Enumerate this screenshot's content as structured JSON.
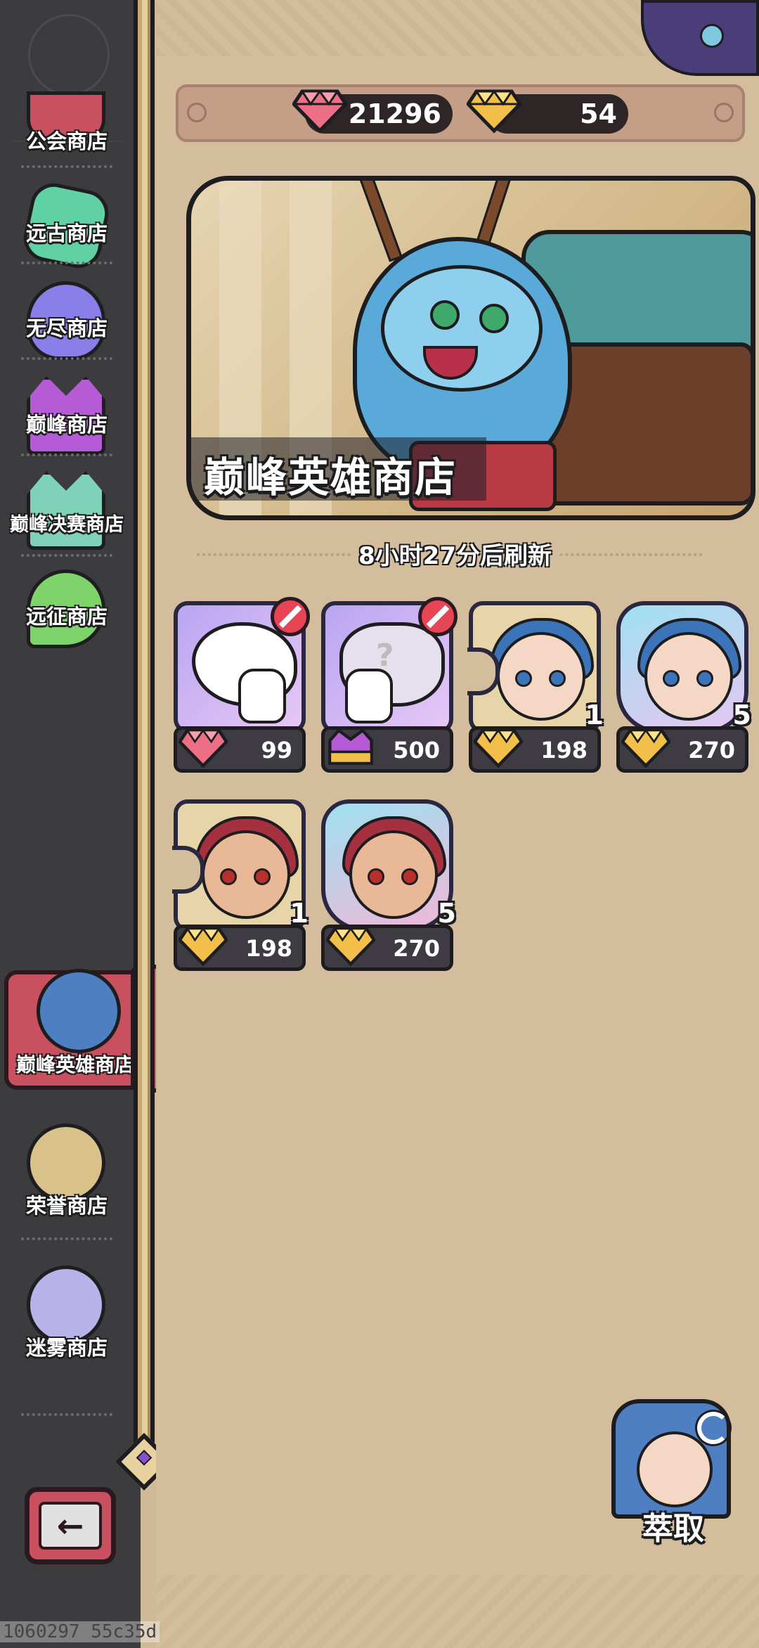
{
  "currencies": [
    {
      "name": "pink-gem",
      "value": "21296",
      "color": "#ec6f86"
    },
    {
      "name": "gold-gem",
      "value": "54",
      "color": "#f2c04a"
    }
  ],
  "banner": {
    "title": "巅峰英雄商店"
  },
  "refresh": {
    "text": "8小时27分后刷新"
  },
  "sidebar": {
    "items": [
      {
        "label": "公会商店",
        "icon": "guild-icon",
        "color": "#c9505f"
      },
      {
        "label": "远古商店",
        "icon": "ancient-crystal-icon",
        "color": "#5fd1a5"
      },
      {
        "label": "无尽商店",
        "icon": "slime-icon",
        "color": "#8a7ee8"
      },
      {
        "label": "巅峰商店",
        "icon": "crown-icon",
        "color": "#b55bd6"
      },
      {
        "label": "巅峰决赛商店",
        "icon": "finals-crown-icon",
        "color": "#7fd1b8"
      },
      {
        "label": "远征商店",
        "icon": "green-slime-icon",
        "color": "#7ed36a"
      },
      {
        "label": "巅峰英雄商店",
        "icon": "hero-portrait-icon",
        "color": "#4d7fc2"
      },
      {
        "label": "荣誉商店",
        "icon": "crossed-swords-icon",
        "color": "#d8c28a"
      },
      {
        "label": "迷雾商店",
        "icon": "mist-orb-icon",
        "color": "#b7b2e8"
      }
    ]
  },
  "items": [
    {
      "type": "blob-hand",
      "price": "99",
      "currency": "pink-gem",
      "blocked": true,
      "qty": ""
    },
    {
      "type": "mystery-hand",
      "price": "500",
      "currency": "purple-crown",
      "blocked": true,
      "qty": ""
    },
    {
      "type": "blue-hero-shard",
      "price": "198",
      "currency": "gold-gem",
      "blocked": false,
      "qty": "1"
    },
    {
      "type": "blue-hero-card",
      "price": "270",
      "currency": "gold-gem",
      "blocked": false,
      "qty": "5"
    },
    {
      "type": "red-hero-shard",
      "price": "198",
      "currency": "gold-gem",
      "blocked": false,
      "qty": "1"
    },
    {
      "type": "red-hero-card",
      "price": "270",
      "currency": "gold-gem",
      "blocked": false,
      "qty": "5"
    }
  ],
  "extract": {
    "label": "萃取"
  },
  "debug": {
    "text": "1060297 55c35d"
  }
}
